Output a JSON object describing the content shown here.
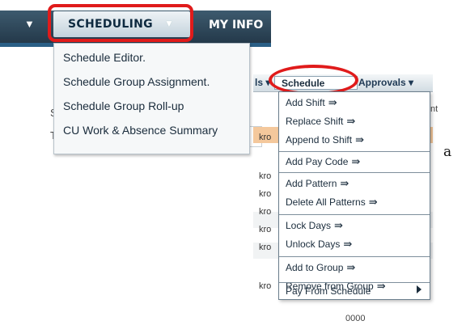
{
  "topnav": {
    "collapse_icon": "caret-down-icon",
    "scheduling_tab": "SCHEDULING",
    "scheduling_caret": "▼",
    "myinfo_tab": "MY INFO"
  },
  "scheduling_menu": {
    "items": [
      "Schedule Editor.",
      "Schedule Group Assignment.",
      "Schedule Group Roll-up",
      "CU Work & Absence Summary"
    ]
  },
  "background": {
    "fragment_s": "S",
    "fragment_t": "T"
  },
  "grid": {
    "toolbar_prev": "ls ▾",
    "schedule_tab": "Schedule",
    "approvals_tab": "Approvals ▾",
    "right_edge_text": "nt",
    "rows": [
      "kro",
      "kro",
      "kro",
      "kro",
      "kro",
      "kro",
      "kro"
    ],
    "bottom_value": "0000"
  },
  "schedule_menu": {
    "arrow_glyph": "⇛",
    "groups": [
      [
        "Add Shift",
        "Replace Shift",
        "Append to Shift"
      ],
      [
        "Add Pay Code"
      ],
      [
        "Add Pattern",
        "Delete All Patterns"
      ],
      [
        "Lock Days",
        "Unlock Days"
      ],
      [
        "Add to Group",
        "Remove from Group"
      ],
      [
        "Pay From Schedule"
      ]
    ]
  },
  "side_letter": "a",
  "colors": {
    "highlight_ring": "#e01b1b",
    "nav_bar": "#24394a",
    "highlight_row": "#f4c89c"
  }
}
